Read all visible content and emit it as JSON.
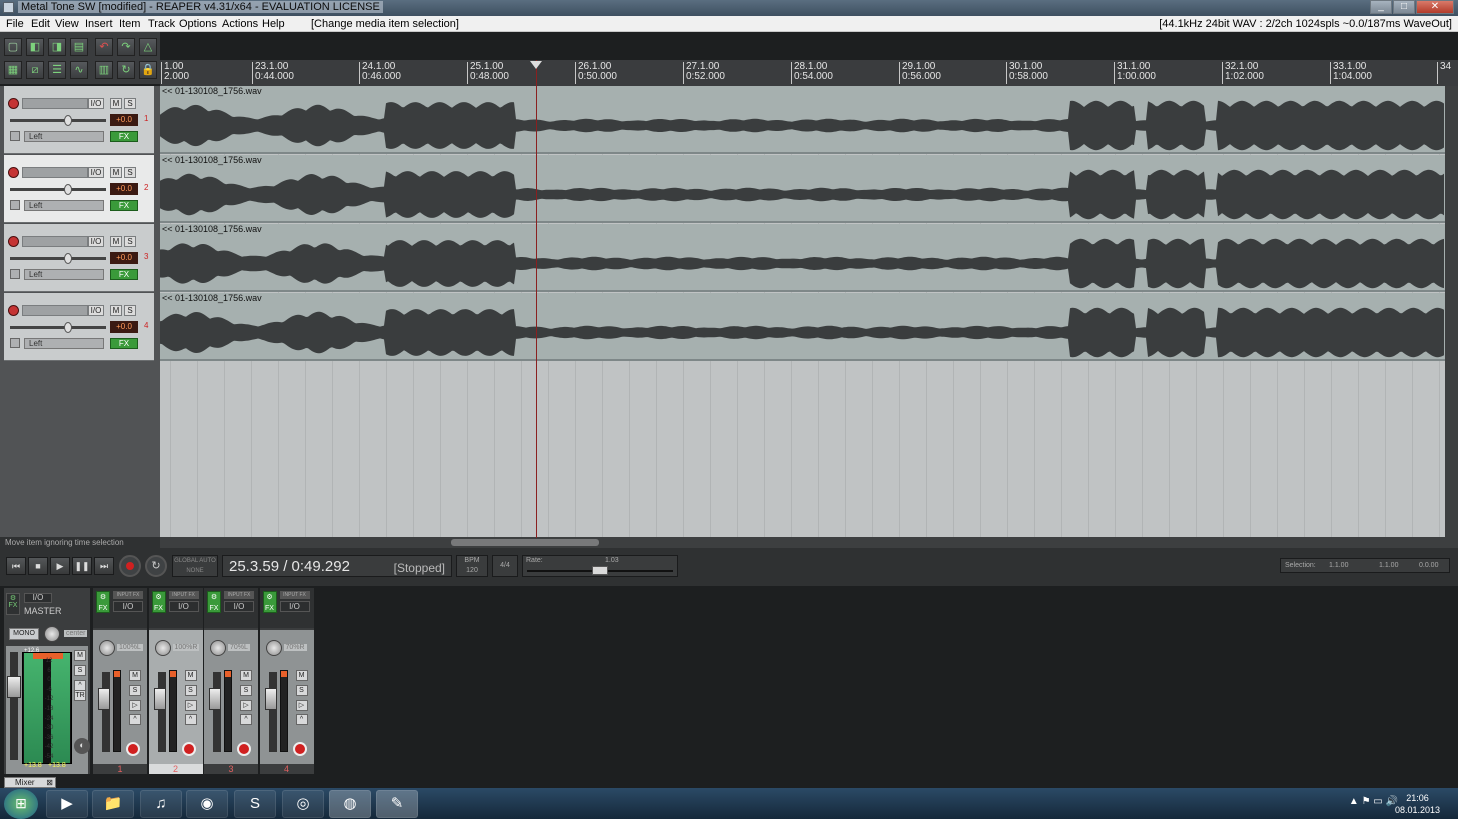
{
  "window": {
    "title": "Metal Tone SW [modified] - REAPER v4.31/x64 - EVALUATION LICENSE",
    "min_icon": "minimize-icon",
    "max_icon": "maximize-icon",
    "close_icon": "close-icon"
  },
  "menu": {
    "items": [
      "File",
      "Edit",
      "View",
      "Insert",
      "Item",
      "Track",
      "Options",
      "Actions",
      "Help"
    ],
    "last_action": "[Change media item selection]",
    "audio_status": "[44.1kHz 24bit WAV : 2/2ch 1024spls ~0.0/187ms WaveOut]"
  },
  "ruler": {
    "ticks": [
      {
        "measure": "1.00",
        "time": "2.000"
      },
      {
        "measure": "23.1.00",
        "time": "0:44.000"
      },
      {
        "measure": "24.1.00",
        "time": "0:46.000"
      },
      {
        "measure": "25.1.00",
        "time": "0:48.000"
      },
      {
        "measure": "26.1.00",
        "time": "0:50.000"
      },
      {
        "measure": "27.1.00",
        "time": "0:52.000"
      },
      {
        "measure": "28.1.00",
        "time": "0:54.000"
      },
      {
        "measure": "29.1.00",
        "time": "0:56.000"
      },
      {
        "measure": "30.1.00",
        "time": "0:58.000"
      },
      {
        "measure": "31.1.00",
        "time": "1:00.000"
      },
      {
        "measure": "32.1.00",
        "time": "1:02.000"
      },
      {
        "measure": "33.1.00",
        "time": "1:04.000"
      },
      {
        "measure": "34",
        "time": ""
      }
    ]
  },
  "tracks": [
    {
      "number": "1",
      "io": "I/O",
      "mute": "M",
      "solo": "S",
      "volume": "+0.0",
      "pan_mode": "Left",
      "fx": "FX",
      "item_name": "<< 01-130108_1756.wav",
      "selected": false
    },
    {
      "number": "2",
      "io": "I/O",
      "mute": "M",
      "solo": "S",
      "volume": "+0.0",
      "pan_mode": "Left",
      "fx": "FX",
      "item_name": "<< 01-130108_1756.wav",
      "selected": true
    },
    {
      "number": "3",
      "io": "I/O",
      "mute": "M",
      "solo": "S",
      "volume": "+0.0",
      "pan_mode": "Left",
      "fx": "FX",
      "item_name": "<< 01-130108_1756.wav",
      "selected": false
    },
    {
      "number": "4",
      "io": "I/O",
      "mute": "M",
      "solo": "S",
      "volume": "+0.0",
      "pan_mode": "Left",
      "fx": "FX",
      "item_name": "<< 01-130108_1756.wav",
      "selected": false
    }
  ],
  "status_line": "Move item ignoring time selection",
  "transport": {
    "position": "25.3.59 / 0:49.292",
    "state": "[Stopped]",
    "global_auto_top": "GLOBAL AUTO",
    "global_auto_bottom": "NONE",
    "bpm_label": "BPM",
    "bpm": "120",
    "time_signature": "4/4",
    "rate_label": "Rate:",
    "rate_value": "1.03",
    "rate_fraction": 0.5,
    "selection_label": "Selection:",
    "sel_start": "1.1.00",
    "sel_end": "1.1.00",
    "sel_length": "0.0.00"
  },
  "master": {
    "label": "MASTER",
    "io": "I/O",
    "fx": "FX",
    "mono": "MONO",
    "pan": "center",
    "mute": "M",
    "solo": "S",
    "trim": "TR",
    "peak_left": "+13.8",
    "peak_right": "+13.8",
    "peak_top": "+12.6",
    "meter_scale": [
      "12",
      "6",
      "0",
      "-6",
      "-12",
      "-18",
      "-24",
      "-30",
      "-36",
      "-42",
      "-54"
    ]
  },
  "mixer_strips": [
    {
      "number": "1",
      "pan": "100%L",
      "fx": "FX",
      "input_fx": "INPUT FX",
      "io": "I/O",
      "mute": "M",
      "solo": "S",
      "selected": false
    },
    {
      "number": "2",
      "pan": "100%R",
      "fx": "FX",
      "input_fx": "INPUT FX",
      "io": "I/O",
      "mute": "M",
      "solo": "S",
      "selected": true
    },
    {
      "number": "3",
      "pan": "70%L",
      "fx": "FX",
      "input_fx": "INPUT FX",
      "io": "I/O",
      "mute": "M",
      "solo": "S",
      "selected": false
    },
    {
      "number": "4",
      "pan": "70%R",
      "fx": "FX",
      "input_fx": "INPUT FX",
      "io": "I/O",
      "mute": "M",
      "solo": "S",
      "selected": false
    }
  ],
  "mixer_tab": "Mixer",
  "taskbar": {
    "apps": [
      "media-player-icon",
      "explorer-icon",
      "itunes-icon",
      "chrome-icon",
      "skype-icon",
      "disc-icon",
      "reaper-icon",
      "paint-icon"
    ],
    "time": "21:06",
    "date": "08.01.2013"
  },
  "colors": {
    "waveform": "#3a3d3e",
    "item_bg": "#a6b0af",
    "record": "#d02020",
    "fx_green": "#3a9a3a"
  }
}
